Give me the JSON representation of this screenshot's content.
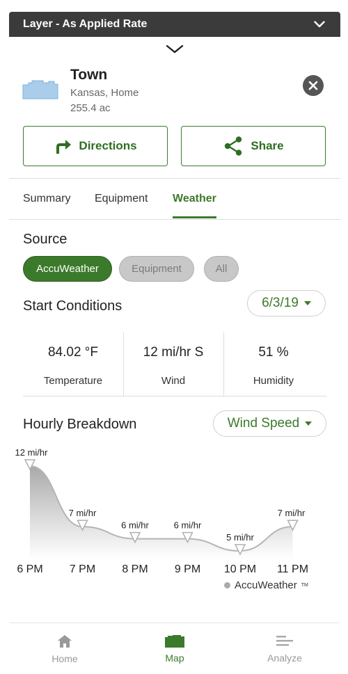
{
  "layer_bar": {
    "label": "Layer - As Applied Rate"
  },
  "field": {
    "name": "Town",
    "location": "Kansas, Home",
    "area": "255.4 ac"
  },
  "actions": {
    "directions": "Directions",
    "share": "Share"
  },
  "tabs": [
    {
      "label": "Summary",
      "active": false
    },
    {
      "label": "Equipment",
      "active": false
    },
    {
      "label": "Weather",
      "active": true
    }
  ],
  "source": {
    "title": "Source",
    "options": [
      {
        "label": "AccuWeather",
        "selected": true
      },
      {
        "label": "Equipment",
        "selected": false
      },
      {
        "label": "All",
        "selected": false
      }
    ]
  },
  "start_conditions": {
    "title": "Start Conditions",
    "date": "6/3/19",
    "items": [
      {
        "value": "84.02 °F",
        "label": "Temperature"
      },
      {
        "value": "12 mi/hr S",
        "label": "Wind"
      },
      {
        "value": "51 %",
        "label": "Humidity"
      }
    ]
  },
  "hourly": {
    "title": "Hourly Breakdown",
    "metric": "Wind Speed"
  },
  "chart_data": {
    "type": "area",
    "categories": [
      "6 PM",
      "7 PM",
      "8 PM",
      "9 PM",
      "10 PM",
      "11 PM"
    ],
    "values": [
      12,
      7,
      6,
      6,
      5,
      7
    ],
    "data_labels": [
      "12 mi/hr",
      "7 mi/hr",
      "6 mi/hr",
      "6 mi/hr",
      "5 mi/hr",
      "7 mi/hr"
    ],
    "unit": "mi/hr",
    "title": "",
    "xlabel": "",
    "ylabel": "",
    "grid": false
  },
  "credit": {
    "label": "AccuWeather",
    "mark": "TM"
  },
  "nav": [
    {
      "label": "Home",
      "icon": "home-icon",
      "active": false
    },
    {
      "label": "Map",
      "icon": "map-icon",
      "active": true
    },
    {
      "label": "Analyze",
      "icon": "analyze-icon",
      "active": false
    }
  ],
  "colors": {
    "accent": "#3c7a2b",
    "header_bg": "#3b3b3b",
    "field_fill": "#a9cdea"
  }
}
